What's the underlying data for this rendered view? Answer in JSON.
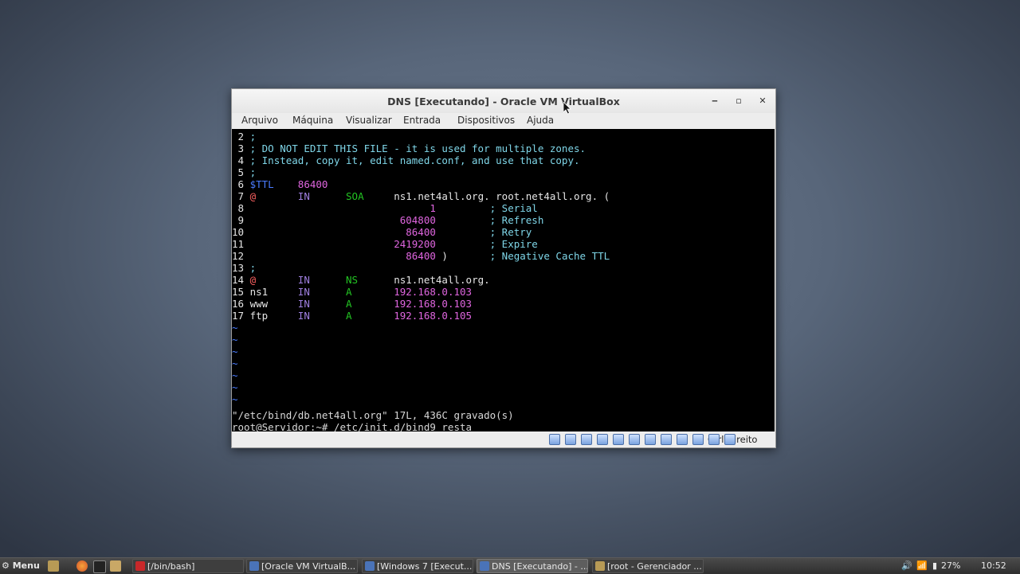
{
  "window": {
    "title": "DNS [Executando] - Oracle VM VirtualBox",
    "minimize_glyph": "‒",
    "maximize_glyph": "▫",
    "close_glyph": "✕"
  },
  "menu": [
    "Arquivo",
    "Máquina",
    "Visualizar",
    "Entrada",
    "Dispositivos",
    "Ajuda"
  ],
  "terminal": {
    "lines": [
      {
        "num": " 2",
        "parts": [
          {
            "t": " ;",
            "c": "cm"
          }
        ]
      },
      {
        "num": " 3",
        "parts": [
          {
            "t": " ; DO NOT EDIT THIS FILE - it is used for multiple zones.",
            "c": "cm"
          }
        ]
      },
      {
        "num": " 4",
        "parts": [
          {
            "t": " ; Instead, copy it, edit named.conf, and use that copy.",
            "c": "cm"
          }
        ]
      },
      {
        "num": " 5",
        "parts": [
          {
            "t": " ;",
            "c": "cm"
          }
        ]
      },
      {
        "num": " 6",
        "parts": [
          {
            "t": " $TTL",
            "c": "tl"
          },
          {
            "t": "    86400",
            "c": "mg"
          }
        ]
      },
      {
        "num": " 7",
        "parts": [
          {
            "t": " @",
            "c": "rd"
          },
          {
            "t": "       IN",
            "c": "pu"
          },
          {
            "t": "      SOA",
            "c": "gr"
          },
          {
            "t": "     ns1.net4all.org. root.net4all.org. (",
            "c": "wh"
          }
        ]
      },
      {
        "num": " 8",
        "parts": [
          {
            "t": "                               1",
            "c": "mg"
          },
          {
            "t": "         ; Serial",
            "c": "cm"
          }
        ]
      },
      {
        "num": " 9",
        "parts": [
          {
            "t": "                          604800",
            "c": "mg"
          },
          {
            "t": "         ; Refresh",
            "c": "cm"
          }
        ]
      },
      {
        "num": "10",
        "parts": [
          {
            "t": "                           86400",
            "c": "mg"
          },
          {
            "t": "         ; Retry",
            "c": "cm"
          }
        ]
      },
      {
        "num": "11",
        "parts": [
          {
            "t": "                         2419200",
            "c": "mg"
          },
          {
            "t": "         ; Expire",
            "c": "cm"
          }
        ]
      },
      {
        "num": "12",
        "parts": [
          {
            "t": "                           86400",
            "c": "mg"
          },
          {
            "t": " )",
            "c": "wh"
          },
          {
            "t": "       ; Negative Cache TTL",
            "c": "cm"
          }
        ]
      },
      {
        "num": "13",
        "parts": [
          {
            "t": " ;",
            "c": "cm"
          }
        ]
      },
      {
        "num": "14",
        "parts": [
          {
            "t": " @",
            "c": "rd"
          },
          {
            "t": "       IN",
            "c": "pu"
          },
          {
            "t": "      NS",
            "c": "gr"
          },
          {
            "t": "      ns1.net4all.org.",
            "c": "wh"
          }
        ]
      },
      {
        "num": "15",
        "parts": [
          {
            "t": " ns1",
            "c": "wh"
          },
          {
            "t": "     IN",
            "c": "pu"
          },
          {
            "t": "      A",
            "c": "gr"
          },
          {
            "t": "       192.168.0.103",
            "c": "mg"
          }
        ]
      },
      {
        "num": "16",
        "parts": [
          {
            "t": " www",
            "c": "wh"
          },
          {
            "t": "     IN",
            "c": "pu"
          },
          {
            "t": "      A",
            "c": "gr"
          },
          {
            "t": "       192.168.0.103",
            "c": "mg"
          }
        ]
      },
      {
        "num": "17",
        "parts": [
          {
            "t": " ftp",
            "c": "wh"
          },
          {
            "t": "     IN",
            "c": "pu"
          },
          {
            "t": "      A",
            "c": "gr"
          },
          {
            "t": "       192.168.0.105",
            "c": "mg"
          }
        ]
      }
    ],
    "tilde": "~",
    "tilde_count": 7,
    "status_line": "\"/etc/bind/db.net4all.org\" 17L, 436C gravado(s)",
    "prompt_line": "root@Servidor:~# /etc/init.d/bind9 resta_"
  },
  "statusbar": {
    "host_key": "Ctrl Direito",
    "icons": [
      "hard-disk-icon",
      "optical-drive-icon",
      "audio-icon",
      "network-icon",
      "usb-icon",
      "shared-folders-icon",
      "display-icon",
      "video-capture-icon",
      "recording-icon",
      "cpu-icon",
      "mouse-integration-icon",
      "guest-additions-icon"
    ]
  },
  "taskbar": {
    "menu_label": "Menu",
    "tasks": [
      {
        "label": "[/bin/bash]",
        "icon": "terminal-icon",
        "active": false
      },
      {
        "label": "[Oracle VM VirtualB...",
        "icon": "virtualbox-icon",
        "active": false
      },
      {
        "label": "[Windows 7 [Execut...",
        "icon": "virtualbox-icon",
        "active": false
      },
      {
        "label": "DNS [Executando] - ...",
        "icon": "virtualbox-icon",
        "active": true
      },
      {
        "label": "[root - Gerenciador ...",
        "icon": "file-manager-icon",
        "active": false
      }
    ],
    "battery": "27%",
    "clock": "10:52"
  },
  "colors": {
    "terminal_bg": "#000000",
    "comment": "#7fd6e8",
    "number": "#e066e0",
    "keyword_in": "#9f7fe0",
    "record_type": "#22c422",
    "at_sign": "#ff6262"
  }
}
